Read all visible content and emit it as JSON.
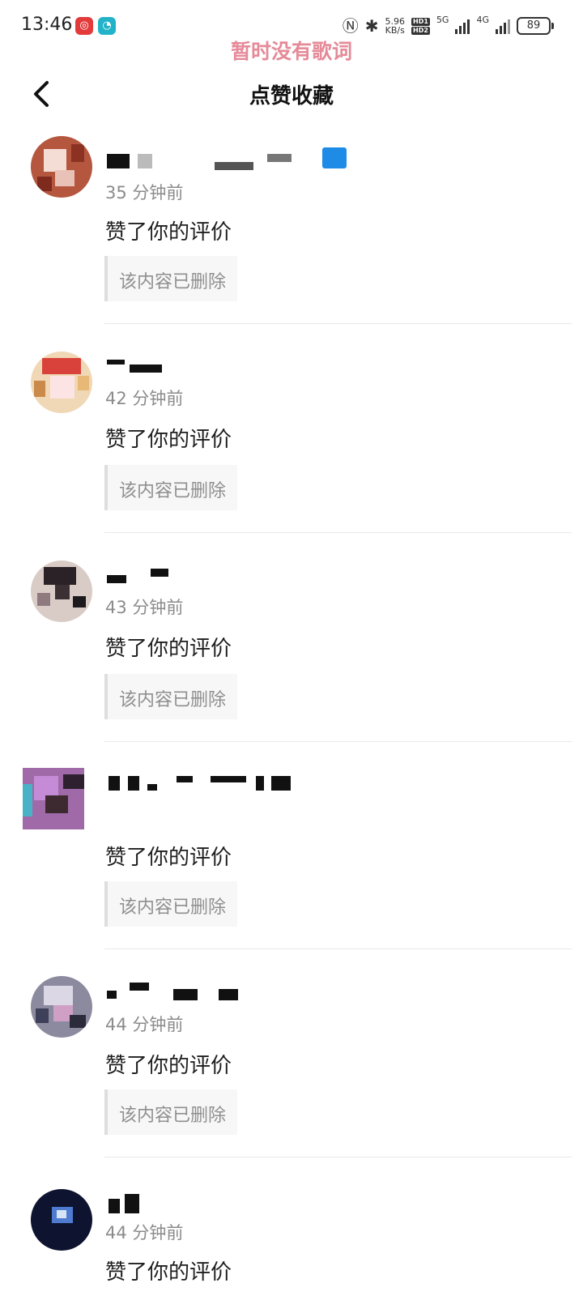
{
  "status_bar": {
    "time": "13:46",
    "app_icons": [
      "netease-music-icon",
      "app-icon"
    ],
    "network_speed_value": "5.96",
    "network_speed_unit": "KB/s",
    "hd1": "HD1",
    "hd2": "HD2",
    "sim1_type": "5G",
    "sim2_type": "4G",
    "battery": "89"
  },
  "lyric_bar": {
    "text": "暂时没有歌词"
  },
  "header": {
    "title": "点赞收藏",
    "back_icon": "chevron-left-icon"
  },
  "notifications": [
    {
      "time_ago": "35 分钟前",
      "action": "赞了你的评价",
      "quoted": "该内容已删除"
    },
    {
      "time_ago": "42 分钟前",
      "action": "赞了你的评价",
      "quoted": "该内容已删除"
    },
    {
      "time_ago": "43 分钟前",
      "action": "赞了你的评价",
      "quoted": "该内容已删除"
    },
    {
      "time_ago": "",
      "action": "赞了你的评价",
      "quoted": "该内容已删除"
    },
    {
      "time_ago": "44 分钟前",
      "action": "赞了你的评价",
      "quoted": "该内容已删除"
    },
    {
      "time_ago": "44 分钟前",
      "action": "赞了你的评价",
      "quoted": ""
    }
  ],
  "colors": {
    "lyric": "#e58a98",
    "secondary_text": "#8b8b8b",
    "quote_bg": "#f7f7f7",
    "quote_bar": "#dedede",
    "divider": "#e8e8e8",
    "badge": "#1e8ce6"
  }
}
